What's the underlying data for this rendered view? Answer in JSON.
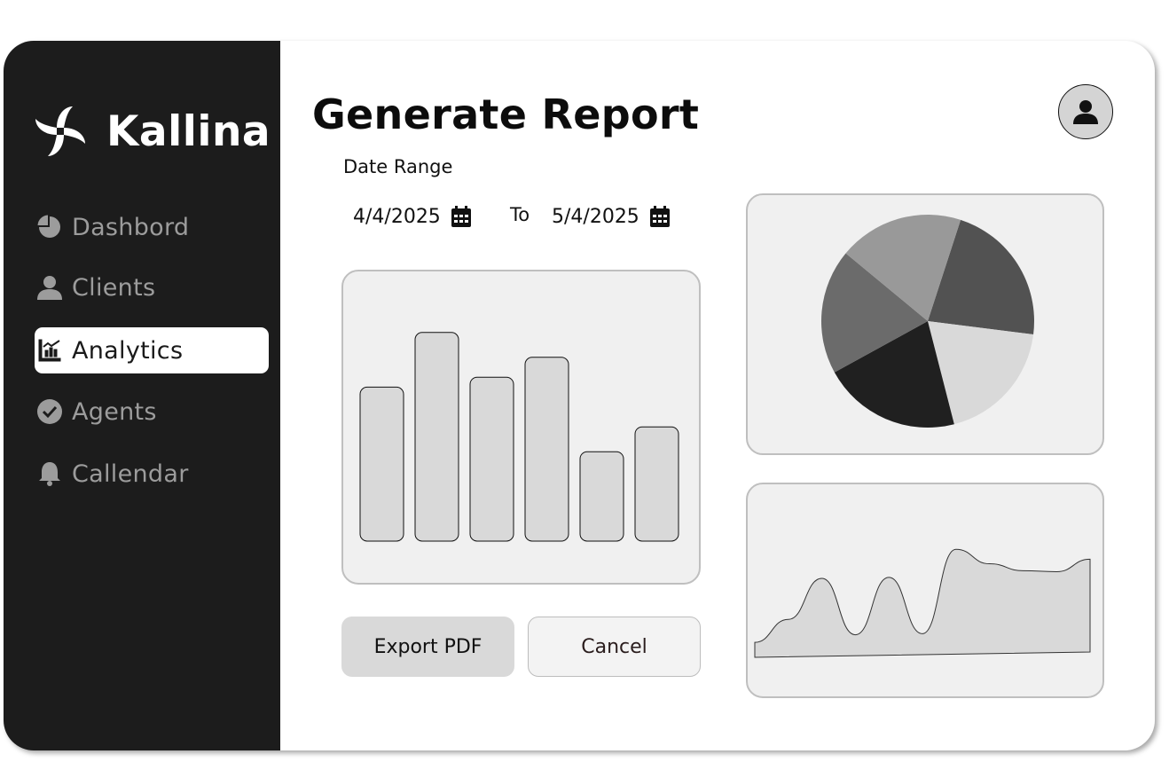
{
  "app": {
    "brand_name": "Kallina"
  },
  "sidebar": {
    "items": [
      {
        "label": "Dashbord",
        "icon": "pie-chart-icon",
        "active": false
      },
      {
        "label": "Clients",
        "icon": "user-icon",
        "active": false
      },
      {
        "label": "Analytics",
        "icon": "chart-bars-icon",
        "active": true
      },
      {
        "label": "Agents",
        "icon": "check-circle-icon",
        "active": false
      },
      {
        "label": "Callendar",
        "icon": "bell-icon",
        "active": false
      }
    ]
  },
  "header": {
    "title": "Generate Report",
    "avatar_icon": "user-avatar-icon"
  },
  "date_range": {
    "label": "Date Range",
    "from": "4/4/2025",
    "separator": "To",
    "to": "5/4/2025",
    "calendar_icon": "calendar-icon"
  },
  "actions": {
    "export_label": "Export PDF",
    "cancel_label": "Cancel"
  },
  "colors": {
    "sidebar_bg": "#1c1c1c",
    "card_bg": "#f0f0f0",
    "active_nav_bg": "#ffffff"
  },
  "chart_data": [
    {
      "type": "bar",
      "categories": [
        "",
        "",
        "",
        "",
        "",
        ""
      ],
      "values": [
        62,
        84,
        66,
        74,
        36,
        46
      ],
      "ylim": [
        0,
        100
      ],
      "fill": "#d9d9d9"
    },
    {
      "type": "pie",
      "values": [
        22,
        19,
        21,
        19,
        19
      ],
      "colors": [
        "#525252",
        "#d9d9d9",
        "#202020",
        "#6b6b6b",
        "#999999"
      ]
    },
    {
      "type": "area",
      "x": [
        0,
        1,
        2,
        3,
        4,
        5,
        6,
        7,
        8,
        9,
        10
      ],
      "values": [
        10,
        25,
        52,
        14,
        52,
        14,
        70,
        60,
        55,
        54,
        62
      ],
      "ylim": [
        0,
        80
      ]
    }
  ]
}
